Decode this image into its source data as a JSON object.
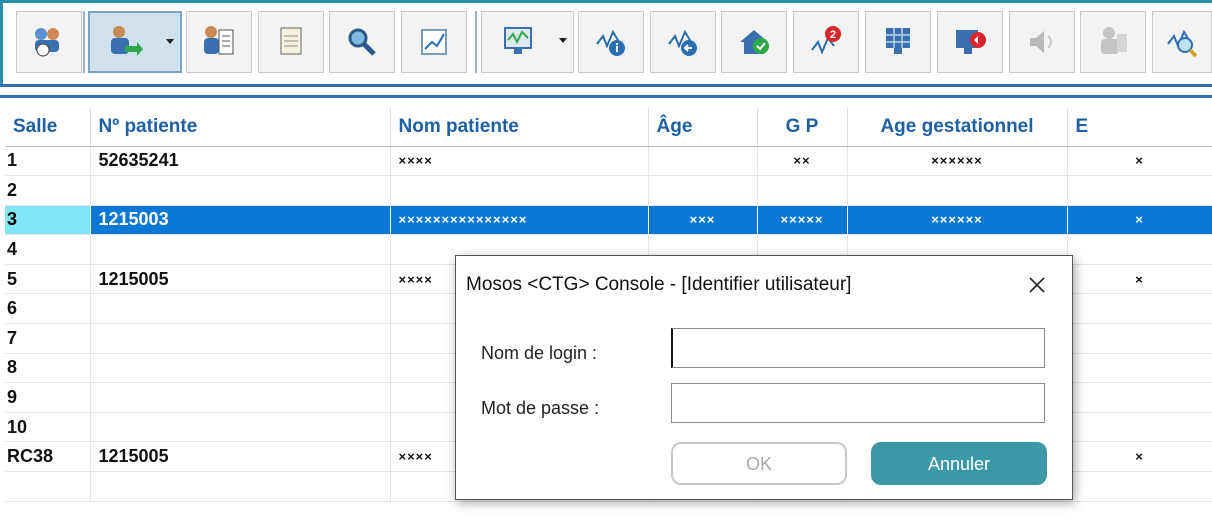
{
  "toolbar": {
    "buttons": [
      {
        "icon": "patients-clock-icon"
      },
      {
        "icon": "patient-arrow-icon",
        "pressed": true,
        "dropdown": true
      },
      {
        "icon": "patient-document-icon"
      },
      {
        "icon": "notepad-icon"
      },
      {
        "icon": "magnifier-icon"
      },
      {
        "icon": "chart-check-icon"
      },
      {
        "icon": "monitor-icon",
        "dropdown": true
      },
      {
        "icon": "trace-info-icon"
      },
      {
        "icon": "trace-back-icon"
      },
      {
        "icon": "home-check-icon"
      },
      {
        "icon": "alert-badge-icon",
        "badge": "2"
      },
      {
        "icon": "grid-monitor-icon"
      },
      {
        "icon": "monitor-sound-icon"
      },
      {
        "icon": "speaker-disabled-icon"
      },
      {
        "icon": "patient-disabled-icon"
      },
      {
        "icon": "trace-zoom-icon"
      }
    ],
    "accent": "#2a8fa8"
  },
  "grid": {
    "columns": [
      "Salle",
      "Nº patiente",
      "Nom patiente",
      "Âge",
      "G P",
      "Age gestationnel",
      "E"
    ],
    "rows": [
      {
        "salle": "1",
        "num": "52635241",
        "nom": "××××",
        "age": "",
        "gp": "××",
        "ag": "××××××",
        "e": "×"
      },
      {
        "salle": "2",
        "num": "",
        "nom": "",
        "age": "",
        "gp": "",
        "ag": "",
        "e": ""
      },
      {
        "salle": "3",
        "num": "1215003",
        "nom": "×××××××××××××××",
        "age": "×××",
        "gp": "×××××",
        "ag": "××××××",
        "e": "×",
        "selected": true
      },
      {
        "salle": "4",
        "num": "",
        "nom": "",
        "age": "",
        "gp": "",
        "ag": "",
        "e": ""
      },
      {
        "salle": "5",
        "num": "1215005",
        "nom": "××××",
        "age": "",
        "gp": "",
        "ag": "",
        "e": "×"
      },
      {
        "salle": "6",
        "num": "",
        "nom": "",
        "age": "",
        "gp": "",
        "ag": "",
        "e": ""
      },
      {
        "salle": "7",
        "num": "",
        "nom": "",
        "age": "",
        "gp": "",
        "ag": "",
        "e": ""
      },
      {
        "salle": "8",
        "num": "",
        "nom": "",
        "age": "",
        "gp": "",
        "ag": "",
        "e": ""
      },
      {
        "salle": "9",
        "num": "",
        "nom": "",
        "age": "",
        "gp": "",
        "ag": "",
        "e": ""
      },
      {
        "salle": "10",
        "num": "",
        "nom": "",
        "age": "",
        "gp": "",
        "ag": "",
        "e": ""
      },
      {
        "salle": "RC38",
        "num": "1215005",
        "nom": "××××",
        "age": "",
        "gp": "",
        "ag": "",
        "e": "×"
      },
      {
        "salle": "",
        "num": "",
        "nom": "",
        "age": "",
        "gp": "",
        "ag": "",
        "e": ""
      }
    ],
    "header_color": "#1f5fa3",
    "selected_color": "#0a78d4"
  },
  "dialog": {
    "title": "Mosos <CTG> Console - [Identifier utilisateur]",
    "close_glyph": "✕",
    "login_label": "Nom de login :",
    "login_value": "",
    "password_label": "Mot de passe :",
    "password_value": "",
    "ok_label": "OK",
    "cancel_label": "Annuler",
    "cancel_color": "#3d98a6"
  }
}
